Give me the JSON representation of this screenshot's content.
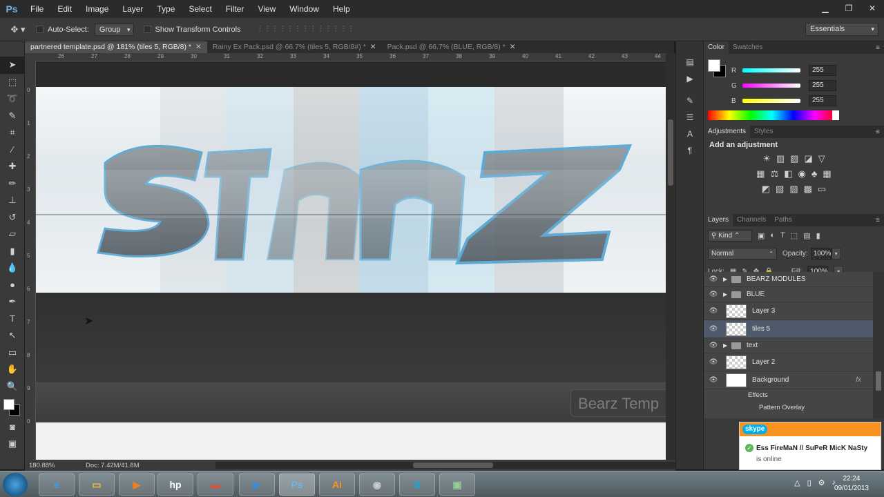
{
  "app": {
    "logo": "Ps"
  },
  "menu": [
    "File",
    "Edit",
    "Image",
    "Layer",
    "Type",
    "Select",
    "Filter",
    "View",
    "Window",
    "Help"
  ],
  "window_controls": {
    "minimize": "▁",
    "restore": "❐",
    "close": "✕"
  },
  "options": {
    "auto_select_label": "Auto-Select:",
    "auto_select_value": "Group",
    "show_transform_label": "Show Transform Controls",
    "workspace": "Essentials"
  },
  "tabs": [
    {
      "label": "partnered template.psd @ 181% (tiles 5, RGB/8) *",
      "active": true
    },
    {
      "label": "Rainy Ex Pack.psd @ 66.7% (tiles 5, RGB/8#) *",
      "active": false
    },
    {
      "label": "Pack.psd @ 66.7% (BLUE, RGB/8) *",
      "active": false
    }
  ],
  "ruler_h_labels": [
    "26",
    "27",
    "28",
    "29",
    "30",
    "31",
    "32",
    "33",
    "34",
    "35",
    "36",
    "37",
    "38",
    "39",
    "40",
    "41",
    "42",
    "43",
    "44"
  ],
  "ruler_v_labels": [
    "0",
    "1",
    "2",
    "3",
    "4",
    "5",
    "6",
    "7",
    "8",
    "9",
    "0"
  ],
  "canvas": {
    "bottom_label": "Bearz Temp"
  },
  "status": {
    "zoom": "180.88%",
    "doc": "Doc: 7.42M/41.8M"
  },
  "color_panel": {
    "tabs": [
      "Color",
      "Swatches"
    ],
    "r_label": "R",
    "g_label": "G",
    "b_label": "B",
    "r": "255",
    "g": "255",
    "b": "255"
  },
  "adjustments_panel": {
    "tabs": [
      "Adjustments",
      "Styles"
    ],
    "title": "Add an adjustment"
  },
  "layers_panel": {
    "tabs": [
      "Layers",
      "Channels",
      "Paths"
    ],
    "kind": "Kind",
    "blend_mode": "Normal",
    "opacity_label": "Opacity:",
    "opacity": "100%",
    "lock_label": "Lock:",
    "fill_label": "Fill:",
    "fill": "100%",
    "layers": [
      {
        "name": "BEARZ MODULES",
        "type": "folder"
      },
      {
        "name": "BLUE",
        "type": "folder"
      },
      {
        "name": "Layer 3",
        "type": "layer"
      },
      {
        "name": "tiles 5",
        "type": "layer",
        "selected": true
      },
      {
        "name": "text",
        "type": "folder"
      },
      {
        "name": "Layer 2",
        "type": "layer"
      },
      {
        "name": "Background",
        "type": "bg"
      }
    ],
    "fx_label": "fx",
    "effects_label": "Effects",
    "pattern_overlay_label": "Pattern Overlay"
  },
  "skype_toast": {
    "logo": "skype",
    "name": "Ess FireMaN // SuPeR MicK NaSty",
    "status": "is online"
  },
  "taskbar": {
    "time": "22:24",
    "date": "09/01/2013"
  },
  "colors": {
    "accent_blue": "#4a90c8",
    "skype_orange": "#f7931e"
  }
}
